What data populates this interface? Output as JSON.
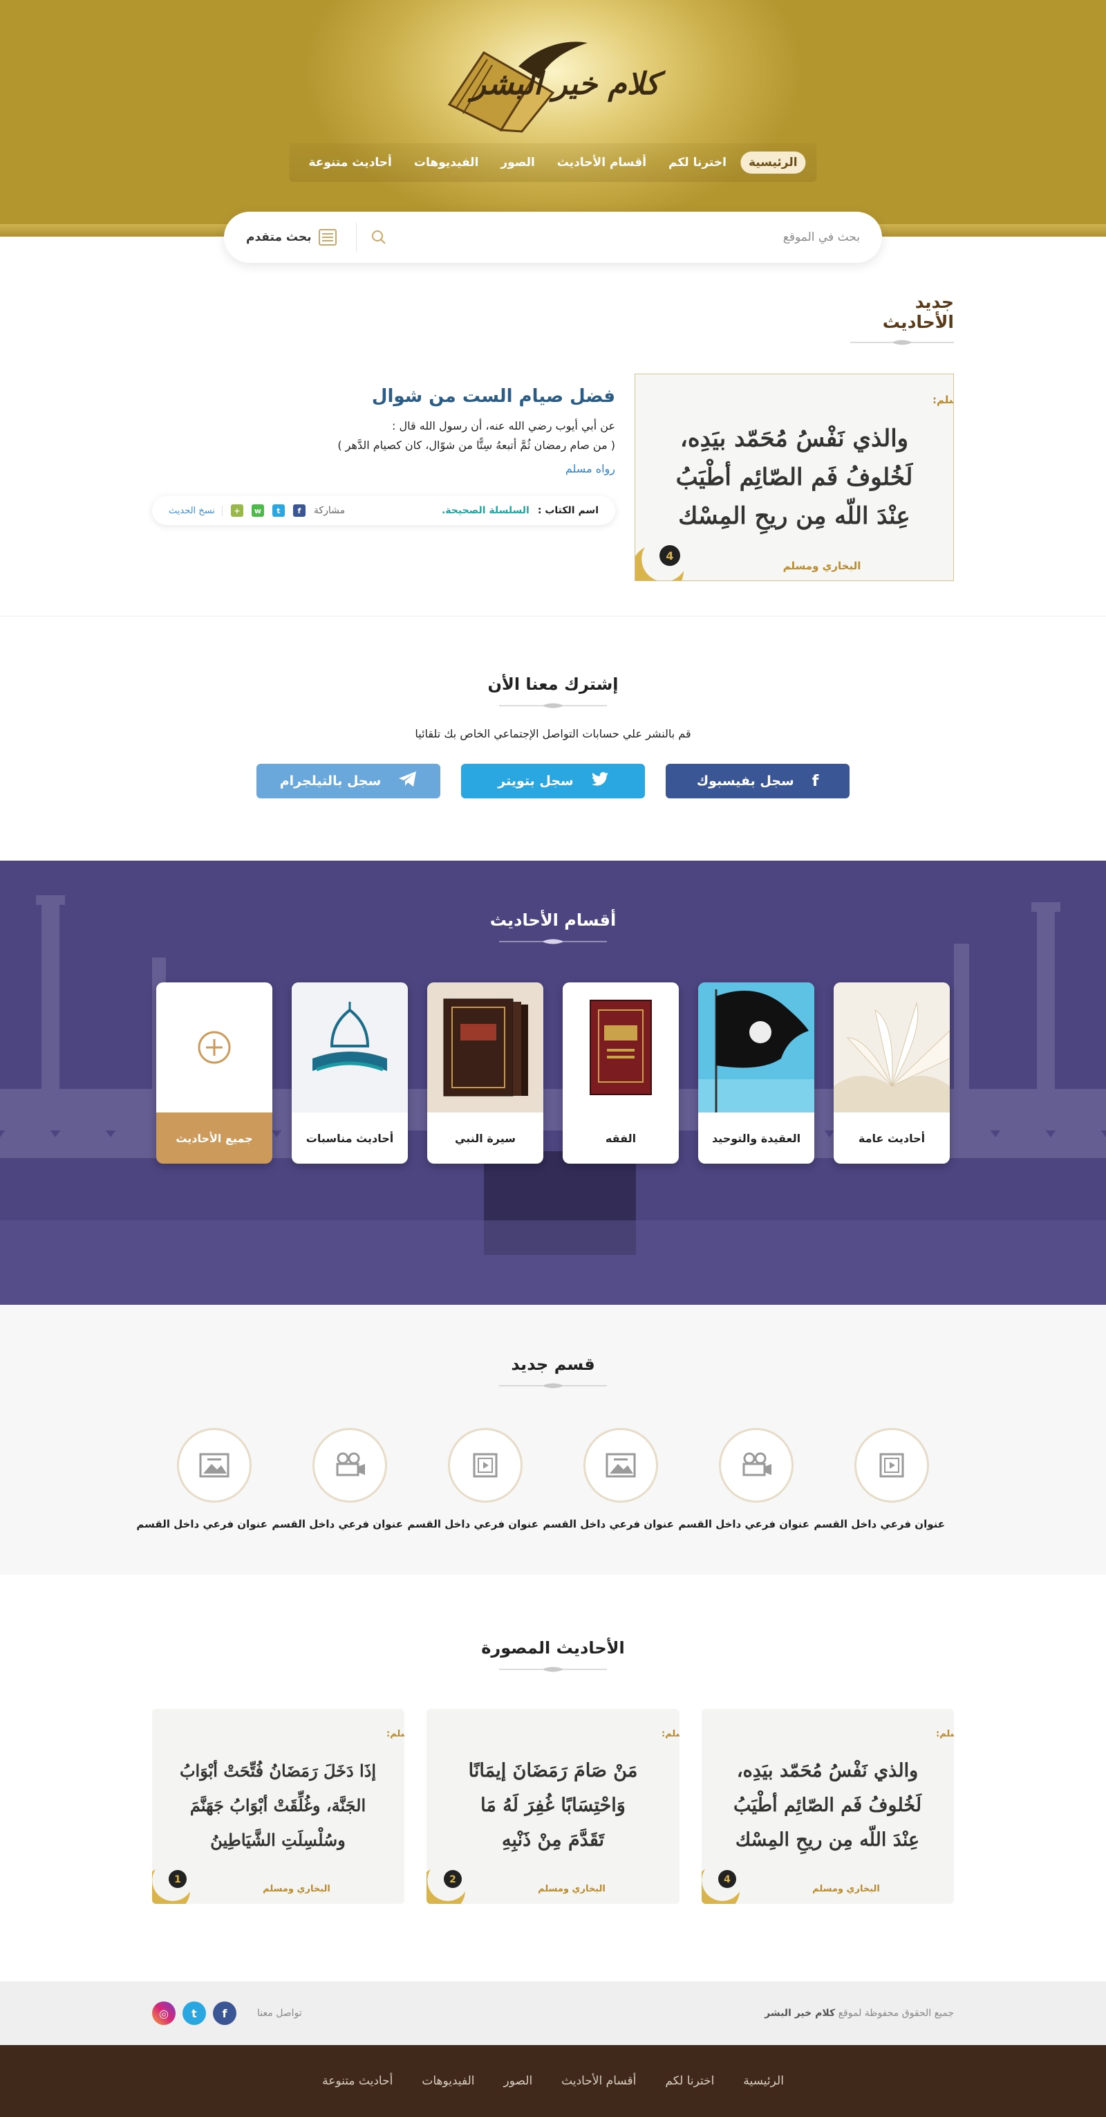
{
  "header": {
    "logo_text": "كلام خير البشر",
    "nav": [
      "الرئيسية",
      "اخترنا لكم",
      "أقسام الأحاديث",
      "الصور",
      "الفيديوهات",
      "أحاديث متنوعة"
    ],
    "nav_active_index": 0
  },
  "search": {
    "placeholder": "بحث في الموقع",
    "advanced_label": "بحث متقدم"
  },
  "latest": {
    "title": "جديد الأحاديث",
    "hadith_title": "فضل صيام الست من شوال",
    "narrator_line": "عن أبي أيوب رضي الله عنه، أن رسول الله قال :",
    "text_line": "( من صام رمضان ثُمَّ أتبعهُ سِتًّا من شوّال، كان كصيام الدَّهر )",
    "narrated_by": "رواه مسلم",
    "book_label": "اسم الكتاب :",
    "book_name": "السلسلة الصحيحة.",
    "share_label": "مشاركة",
    "copy_label": "نسخ الحديث",
    "image": {
      "top": "قال رسول الله صلى الله عليه وسلم:",
      "lines": [
        "والذي نَفْسُ مُحَمّد بيَدِه،",
        "لَخُلوفُ فَم الصّائِم أطْيَبُ",
        "عِنْدَ اللّه مِن ريحِ المِسْك"
      ],
      "source": "البخاري ومسلم",
      "badge": "4"
    }
  },
  "subscribe": {
    "title": "إشترك معنا الأن",
    "desc": "قم بالنشر علي حسابات التواصل الإجتماعي الخاص بك تلقائيا",
    "buttons": [
      {
        "label": "سجل بفيسبوك",
        "icon": "facebook-icon",
        "color": "#3b5694"
      },
      {
        "label": "سجل بتويتر",
        "icon": "twitter-icon",
        "color": "#2aa7e0"
      },
      {
        "label": "سجل بالتيلجرام",
        "icon": "telegram-icon",
        "color": "#6aa8dc"
      }
    ]
  },
  "categories": {
    "title": "أقسام الأحاديث",
    "items": [
      "أحاديث عامة",
      "العقيدة والتوحيد",
      "الفقه",
      "سيرة النبي",
      "أحاديث مناسبات"
    ],
    "all_label": "جميع الأحاديث"
  },
  "new_section": {
    "title": "قسم جديد",
    "items": [
      {
        "label": "عنوان فرعي داخل القسم",
        "icon": "film-icon"
      },
      {
        "label": "عنوان فرعي داخل القسم",
        "icon": "video-camera-icon"
      },
      {
        "label": "عنوان فرعي داخل القسم",
        "icon": "image-icon"
      },
      {
        "label": "عنوان فرعي داخل القسم",
        "icon": "film-icon"
      },
      {
        "label": "عنوان فرعي داخل القسم",
        "icon": "video-camera-icon"
      },
      {
        "label": "عنوان فرعي داخل القسم",
        "icon": "image-icon"
      }
    ]
  },
  "pictures": {
    "title": "الأحاديث المصورة",
    "cards": [
      {
        "top": "قال رسول الله صلى الله عليه وسلم:",
        "lines": [
          "والذي نَفْسُ مُحَمّد بيَدِه،",
          "لَخُلوفُ فَم الصّائِم أطْيَبُ",
          "عِنْدَ اللّه مِن ريحِ المِسْك"
        ],
        "source": "البخاري ومسلم",
        "badge": "4"
      },
      {
        "top": "قال رسول الله صلى الله عليه وسلم:",
        "lines": [
          "مَنْ صَامَ رَمَضَانَ إيمَانًا",
          "وَاحْتِسَابًا غُفِرَ لَهُ مَا",
          "تَقَدَّمَ مِنْ ذَنْبِهِ"
        ],
        "source": "البخاري ومسلم",
        "badge": "2"
      },
      {
        "top": "قال رسول الله صلى الله عليه وسلم:",
        "lines": [
          "إذَا دَخَلَ رَمَضَانُ فُتِّحَتْ أبْوَابُ",
          "الجَنَّة، وغُلِّقَتْ أبْوَابُ جَهَنَّمَ",
          "وسُلْسِلَتِ الشَّيَاطِينُ"
        ],
        "source": "البخاري ومسلم",
        "badge": "1"
      }
    ]
  },
  "footer": {
    "copyright_prefix": "جميع الحقوق محفوظة لموقع",
    "site_name": "كلام خير البشر",
    "contact_label": "تواصل معنا",
    "nav": [
      "الرئيسية",
      "اخترنا لكم",
      "أقسام الأحاديث",
      "الصور",
      "الفيديوهات",
      "أحاديث متنوعة"
    ]
  },
  "colors": {
    "gold": "#c9ad48",
    "brown": "#40291a",
    "purple": "#4a4178",
    "teal": "#23a3a0",
    "blue_title": "#2a5c85"
  }
}
